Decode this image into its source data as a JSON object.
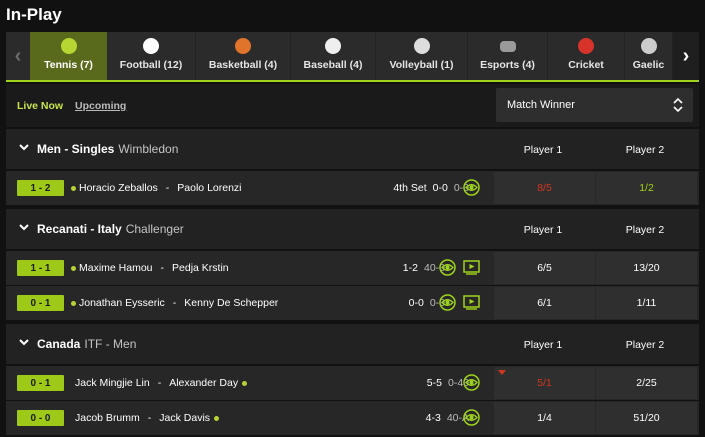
{
  "page_title": "In-Play",
  "sports": [
    {
      "label": "Tennis (7)",
      "icon": "tennis-ball-icon",
      "active": true,
      "color": "#b8d632"
    },
    {
      "label": "Football (12)",
      "icon": "football-icon",
      "active": false,
      "color": "#ffffff"
    },
    {
      "label": "Basketball (4)",
      "icon": "basketball-icon",
      "active": false,
      "color": "#e0742a"
    },
    {
      "label": "Baseball (4)",
      "icon": "baseball-icon",
      "active": false,
      "color": "#efefef"
    },
    {
      "label": "Volleyball (1)",
      "icon": "volleyball-icon",
      "active": false,
      "color": "#dddddd"
    },
    {
      "label": "Esports (4)",
      "icon": "gamepad-icon",
      "active": false,
      "color": "#9a9a9a"
    },
    {
      "label": "Cricket",
      "icon": "cricket-ball-icon",
      "active": false,
      "color": "#d8332a"
    },
    {
      "label": "Gaelic",
      "icon": "gaelic-icon",
      "active": false,
      "color": "#cccccc"
    }
  ],
  "filters": {
    "live_now": "Live Now",
    "upcoming": "Upcoming"
  },
  "market": {
    "selected": "Match Winner"
  },
  "groups": [
    {
      "name": "Men - Singles",
      "subtitle": "Wimbledon",
      "col1": "Player 1",
      "col2": "Player 2",
      "matches": [
        {
          "score": "1 - 2",
          "p1": "Horacio Zeballos",
          "p2": "Paolo Lorenzi",
          "serve": "p1",
          "set": "4th Set",
          "games": "0-0",
          "points": "0-0",
          "video": false,
          "odds1": "8/5",
          "odds2": "1/2",
          "odds1_move": "down",
          "odds2_move": "up"
        }
      ]
    },
    {
      "name": "Recanati - Italy",
      "subtitle": "Challenger",
      "col1": "Player 1",
      "col2": "Player 2",
      "matches": [
        {
          "score": "1 - 1",
          "p1": "Maxime Hamou",
          "p2": "Pedja Krstin",
          "serve": "p1",
          "set": "",
          "games": "1-2",
          "points": "40-0",
          "video": true,
          "odds1": "6/5",
          "odds2": "13/20",
          "odds1_move": "",
          "odds2_move": ""
        },
        {
          "score": "0 - 1",
          "p1": "Jonathan Eysseric",
          "p2": "Kenny De Schepper",
          "serve": "p1",
          "set": "",
          "games": "0-0",
          "points": "0-0",
          "video": true,
          "odds1": "6/1",
          "odds2": "1/11",
          "odds1_move": "",
          "odds2_move": ""
        }
      ]
    },
    {
      "name": "Canada",
      "subtitle": "ITF - Men",
      "col1": "Player 1",
      "col2": "Player 2",
      "matches": [
        {
          "score": "0 - 1",
          "p1": "Jack Mingjie Lin",
          "p2": "Alexander Day",
          "serve": "p2",
          "set": "",
          "games": "5-5",
          "points": "0-40",
          "video": false,
          "odds1": "5/1",
          "odds2": "2/25",
          "odds1_move": "down",
          "odds2_move": ""
        },
        {
          "score": "0 - 0",
          "p1": "Jacob Brumm",
          "p2": "Jack Davis",
          "serve": "p2",
          "set": "",
          "games": "4-3",
          "points": "40-A",
          "video": false,
          "odds1": "1/4",
          "odds2": "51/20",
          "odds1_move": "",
          "odds2_move": ""
        }
      ]
    }
  ]
}
